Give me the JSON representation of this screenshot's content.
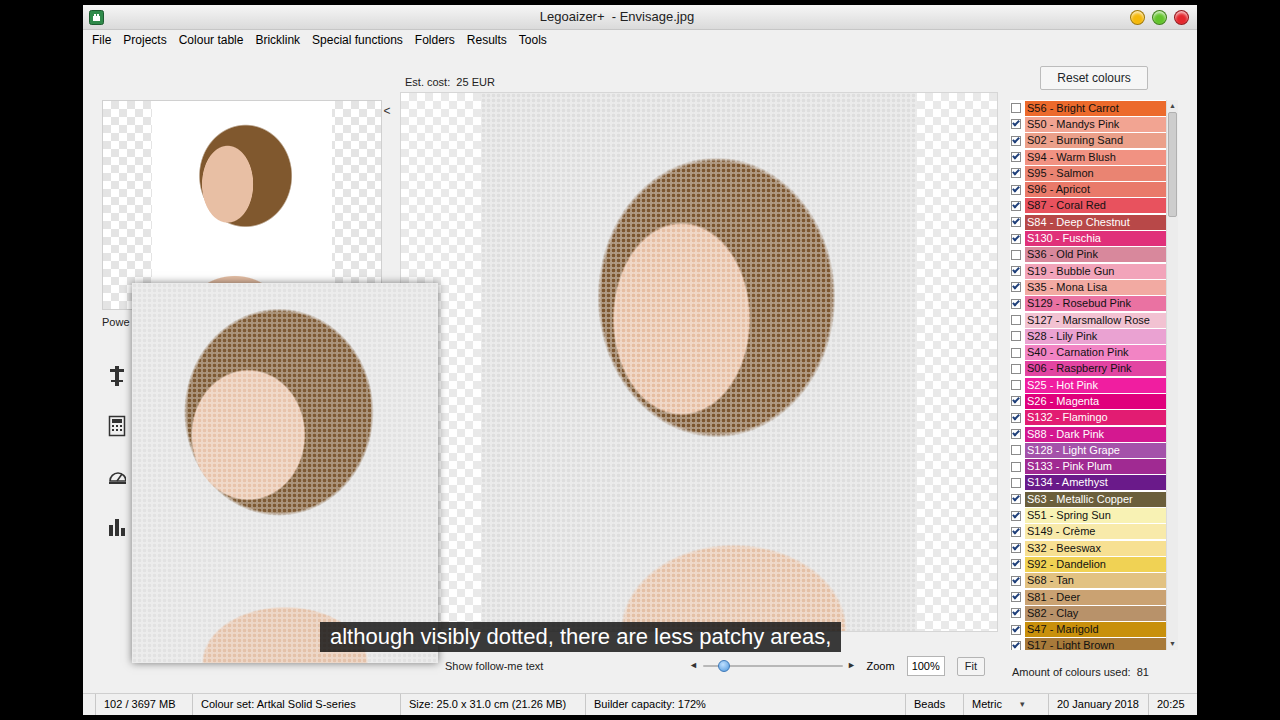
{
  "window": {
    "title": "Legoaizer+  - Envisage.jpg",
    "controls": [
      {
        "color": "#f5b90a"
      },
      {
        "color": "#63c42c"
      },
      {
        "color": "#e4262c"
      }
    ]
  },
  "menu": [
    "File",
    "Projects",
    "Colour table",
    "Bricklink",
    "Special functions",
    "Folders",
    "Results",
    "Tools"
  ],
  "preview": {
    "caption": "Powe",
    "collapse": "<"
  },
  "estimate": "Est. cost:  25 EUR",
  "view": {
    "follow_me": "Show follow-me text",
    "slider": {
      "left": "◄",
      "right": "►",
      "level": 0.15
    },
    "zoom_label": "Zoom",
    "zoom": "100%",
    "fit": "Fit"
  },
  "colours": {
    "reset": "Reset colours",
    "scrollbar": {
      "up": "▲",
      "down": "▼",
      "level": 0.2
    },
    "items": [
      {
        "label": "S56 - Bright Carrot",
        "checked": false,
        "color": "#ec6a2c"
      },
      {
        "label": "S50 - Mandys Pink",
        "checked": true,
        "color": "#f2a492"
      },
      {
        "label": "S02 - Burning Sand",
        "checked": true,
        "color": "#eba08a"
      },
      {
        "label": "S94 - Warm Blush",
        "checked": true,
        "color": "#f19282"
      },
      {
        "label": "S95 - Salmon",
        "checked": true,
        "color": "#ea8472"
      },
      {
        "label": "S96 - Apricot",
        "checked": true,
        "color": "#e97a6a"
      },
      {
        "label": "S87 - Coral Red",
        "checked": true,
        "color": "#e8525e"
      },
      {
        "label": "S84 - Deep Chestnut",
        "checked": true,
        "color": "#b84848"
      },
      {
        "label": "S130 - Fuschia",
        "checked": true,
        "color": "#e0307a"
      },
      {
        "label": "S36 - Old Pink",
        "checked": false,
        "color": "#d8889c"
      },
      {
        "label": "S19 - Bubble Gun",
        "checked": true,
        "color": "#f2a4ba"
      },
      {
        "label": "S35 - Mona Lisa",
        "checked": true,
        "color": "#f2aaa2"
      },
      {
        "label": "S129 - Rosebud Pink",
        "checked": true,
        "color": "#ea72a2"
      },
      {
        "label": "S127 - Marsmallow Rose",
        "checked": false,
        "color": "#f2c2d2"
      },
      {
        "label": "S28 - Lily Pink",
        "checked": false,
        "color": "#eaa2d2"
      },
      {
        "label": "S40 - Carnation Pink",
        "checked": false,
        "color": "#f284c4"
      },
      {
        "label": "S06 - Raspberry Pink",
        "checked": false,
        "color": "#e244a2"
      },
      {
        "label": "S25 - Hot Pink",
        "checked": false,
        "color": "#f01ea0"
      },
      {
        "label": "S26 - Magenta",
        "checked": true,
        "color": "#e0007c"
      },
      {
        "label": "S132 - Flamingo",
        "checked": true,
        "color": "#e21c72"
      },
      {
        "label": "S88 - Dark Pink",
        "checked": true,
        "color": "#d41890"
      },
      {
        "label": "S128 - Light Grape",
        "checked": false,
        "color": "#a452aa"
      },
      {
        "label": "S133 - Pink Plum",
        "checked": false,
        "color": "#a02a92"
      },
      {
        "label": "S134 - Amethyst",
        "checked": false,
        "color": "#6a1a8a"
      },
      {
        "label": "S63 - Metallic Copper",
        "checked": true,
        "color": "#6b5f3c"
      },
      {
        "label": "S51 - Spring Sun",
        "checked": true,
        "color": "#f8f2b4"
      },
      {
        "label": "S149 - Crème",
        "checked": true,
        "color": "#f8eaaa"
      },
      {
        "label": "S32 - Beeswax",
        "checked": true,
        "color": "#f7e092"
      },
      {
        "label": "S92 - Dandelion",
        "checked": true,
        "color": "#f0d254"
      },
      {
        "label": "S68 - Tan",
        "checked": true,
        "color": "#e2c282"
      },
      {
        "label": "S81 - Deer",
        "checked": true,
        "color": "#caa272"
      },
      {
        "label": "S82 - Clay",
        "checked": true,
        "color": "#b8926a"
      },
      {
        "label": "S47 - Marigold",
        "checked": true,
        "color": "#c8900c"
      },
      {
        "label": "S17 - Light Brown",
        "checked": true,
        "color": "#a87a3a"
      }
    ],
    "amount": "Amount of colours used:  81"
  },
  "subtitle": "although visibly dotted, there are less patchy areas,",
  "status_bar": [
    {
      "text": "102 / 3697 MB",
      "kind": "text"
    },
    {
      "text": "Colour set: Artkal Solid S-series",
      "kind": "text"
    },
    {
      "text": "Size: 25.0 x 31.0 cm (21.26 MB)",
      "kind": "text"
    },
    {
      "text": "Builder capacity: 172%",
      "kind": "text"
    },
    {
      "text": "Beads",
      "kind": "text"
    },
    {
      "text": "Metric",
      "kind": "dropdown",
      "arrow": "▾"
    },
    {
      "text": "20 January 2018",
      "kind": "text"
    },
    {
      "text": "20:25",
      "kind": "text"
    }
  ]
}
